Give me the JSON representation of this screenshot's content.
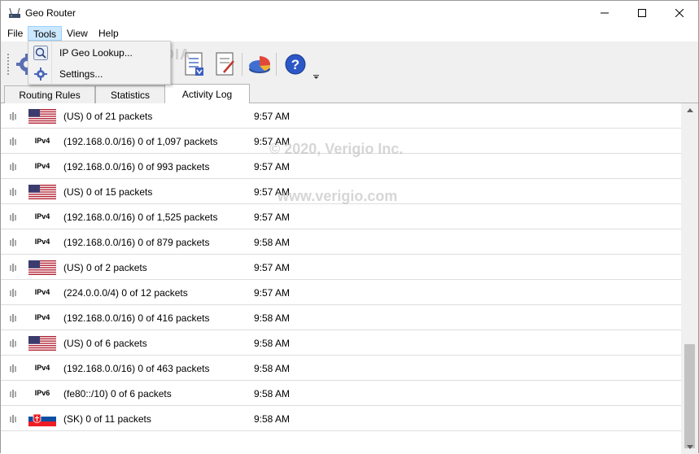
{
  "window": {
    "title": "Geo Router"
  },
  "menu": [
    {
      "label": "File"
    },
    {
      "label": "Tools"
    },
    {
      "label": "View"
    },
    {
      "label": "Help"
    }
  ],
  "tools_menu": {
    "ip_geo_lookup": "IP Geo Lookup...",
    "settings": "Settings..."
  },
  "toolbar": {
    "overflow_icon": "chevron-down-icon",
    "buttons": [
      "settings-gear-icon",
      "log-document-icon",
      "edit-document-icon",
      "statistics-pie-icon",
      "help-icon"
    ]
  },
  "tabs": [
    {
      "label": "Routing Rules"
    },
    {
      "label": "Statistics"
    },
    {
      "label": "Activity Log",
      "active": true
    }
  ],
  "watermarks": {
    "softpedia": "SOFTPEDIA",
    "copyright": "© 2020, Verigio Inc.",
    "url": "www.verigio.com"
  },
  "log": [
    {
      "kind": "flag",
      "flag": "us",
      "text": "(US) 0 of 21 packets",
      "time": "9:57 AM"
    },
    {
      "kind": "ip",
      "ip": "IPv4",
      "text": "(192.168.0.0/16) 0 of 1,097 packets",
      "time": "9:57 AM"
    },
    {
      "kind": "ip",
      "ip": "IPv4",
      "text": "(192.168.0.0/16) 0 of 993 packets",
      "time": "9:57 AM"
    },
    {
      "kind": "flag",
      "flag": "us",
      "text": "(US) 0 of 15 packets",
      "time": "9:57 AM"
    },
    {
      "kind": "ip",
      "ip": "IPv4",
      "text": "(192.168.0.0/16) 0 of 1,525 packets",
      "time": "9:57 AM"
    },
    {
      "kind": "ip",
      "ip": "IPv4",
      "text": "(192.168.0.0/16) 0 of 879 packets",
      "time": "9:58 AM"
    },
    {
      "kind": "flag",
      "flag": "us",
      "text": "(US) 0 of 2 packets",
      "time": "9:57 AM"
    },
    {
      "kind": "ip",
      "ip": "IPv4",
      "text": "(224.0.0.0/4) 0 of 12 packets",
      "time": "9:57 AM"
    },
    {
      "kind": "ip",
      "ip": "IPv4",
      "text": "(192.168.0.0/16) 0 of 416 packets",
      "time": "9:58 AM"
    },
    {
      "kind": "flag",
      "flag": "us",
      "text": "(US) 0 of 6 packets",
      "time": "9:58 AM"
    },
    {
      "kind": "ip",
      "ip": "IPv4",
      "text": "(192.168.0.0/16) 0 of 463 packets",
      "time": "9:58 AM"
    },
    {
      "kind": "ip",
      "ip": "IPv6",
      "text": "(fe80::/10) 0 of 6 packets",
      "time": "9:58 AM"
    },
    {
      "kind": "flag",
      "flag": "sk",
      "text": "(SK) 0 of 11 packets",
      "time": "9:58 AM"
    }
  ],
  "colors": {
    "accent": "#cce8ff",
    "row_divider": "#dedede"
  }
}
